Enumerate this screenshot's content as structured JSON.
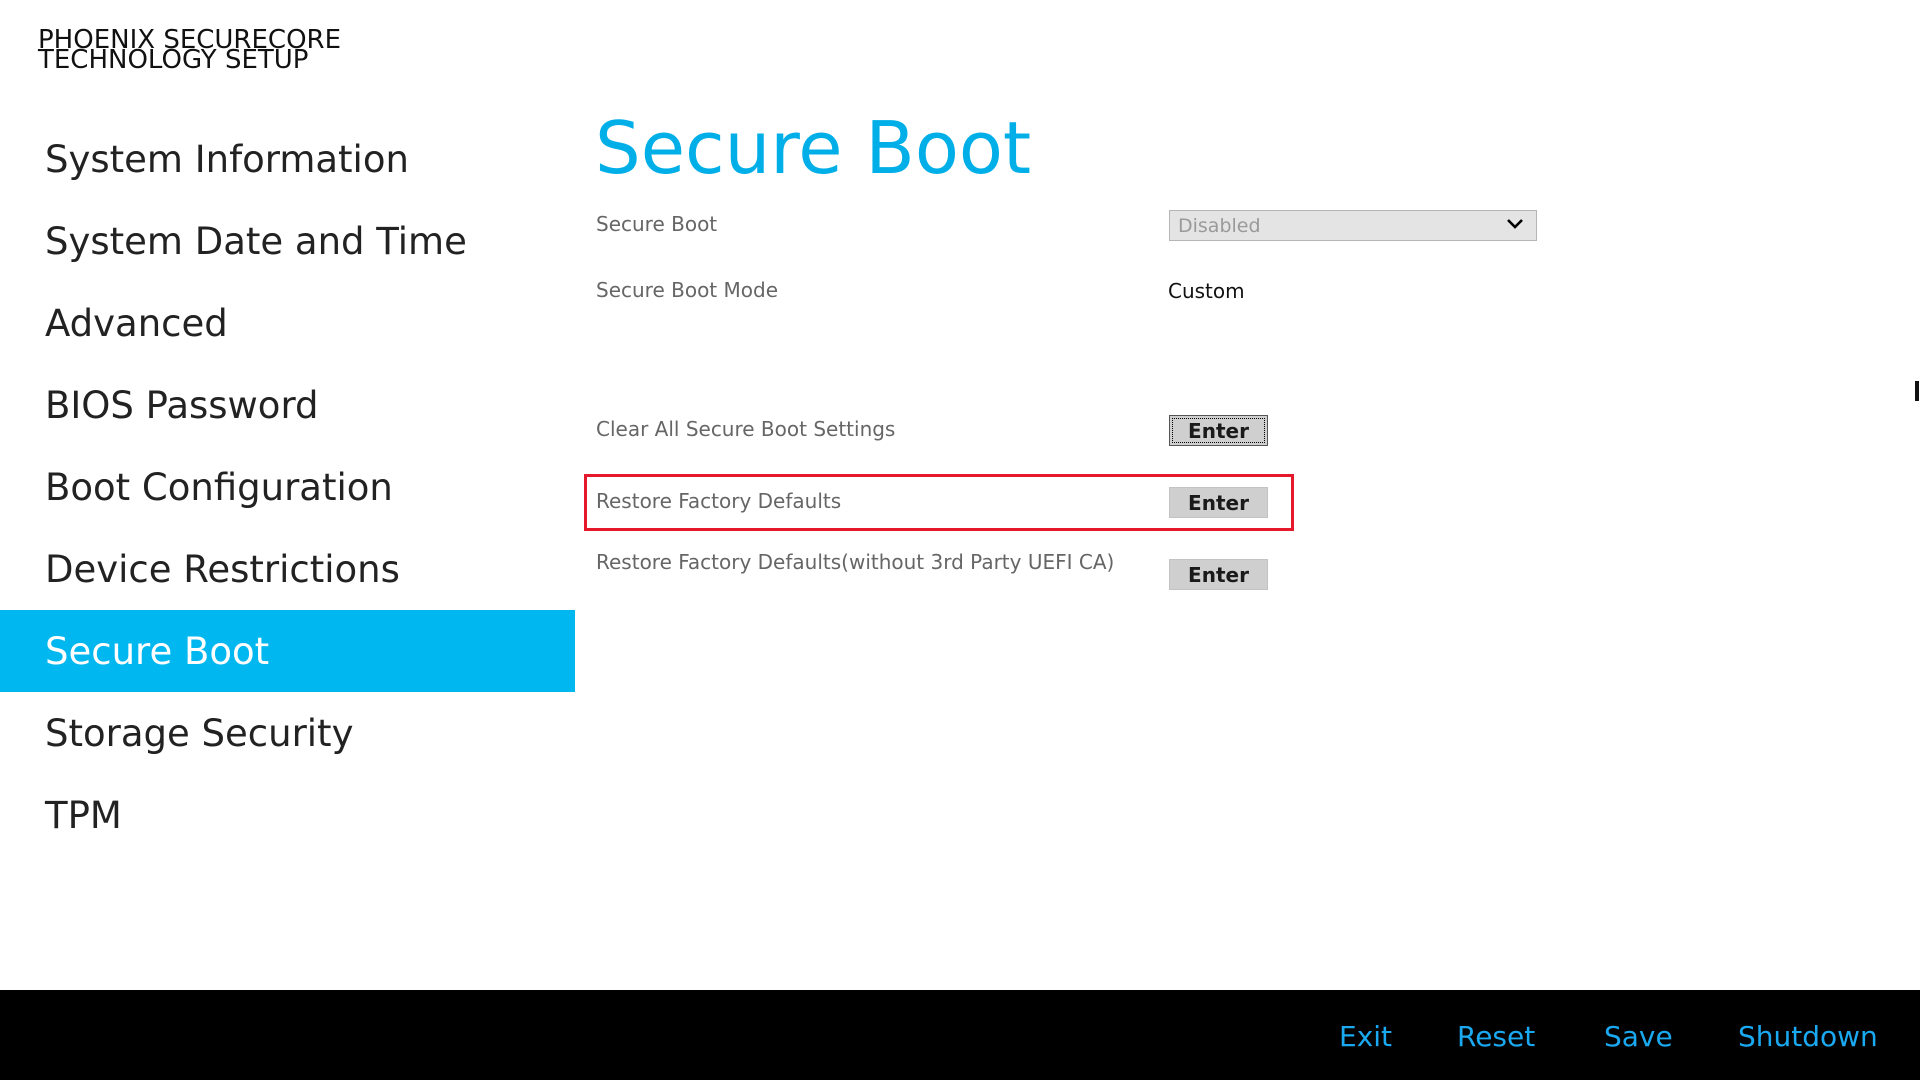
{
  "brand": {
    "line1": "PHOENIX SECURECORE",
    "line2": "TECHNOLOGY SETUP"
  },
  "sidebar": {
    "items": [
      {
        "label": "System Information"
      },
      {
        "label": "System Date and Time"
      },
      {
        "label": "Advanced"
      },
      {
        "label": "BIOS Password"
      },
      {
        "label": "Boot Configuration"
      },
      {
        "label": "Device Restrictions"
      },
      {
        "label": "Secure Boot",
        "active": true
      },
      {
        "label": "Storage Security"
      },
      {
        "label": "TPM"
      }
    ]
  },
  "main": {
    "title": "Secure Boot",
    "settings": {
      "secure_boot": {
        "label": "Secure Boot",
        "value": "Disabled"
      },
      "secure_boot_mode": {
        "label": "Secure Boot Mode",
        "value": "Custom"
      },
      "clear_all": {
        "label": "Clear All Secure Boot Settings",
        "button": "Enter"
      },
      "restore_defaults": {
        "label": "Restore Factory Defaults",
        "button": "Enter"
      },
      "restore_defaults_no_3rd": {
        "label": "Restore Factory Defaults(without 3rd Party UEFI CA)",
        "button": "Enter"
      }
    }
  },
  "footer": {
    "exit": "Exit",
    "reset": "Reset",
    "save": "Save",
    "shutdown": "Shutdown"
  },
  "colors": {
    "accent": "#00b7f0",
    "title": "#00aee8",
    "footer_bg": "#000000",
    "footer_text": "#1aa9f0",
    "highlight": "#e5192b"
  },
  "icons": {
    "dropdown": "chevron-down-icon"
  }
}
